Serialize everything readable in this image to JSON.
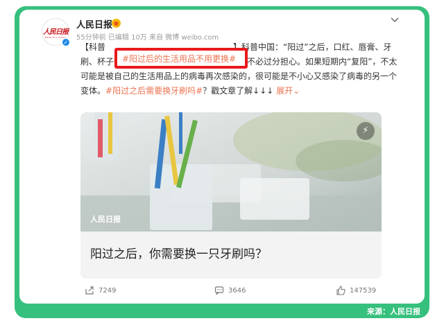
{
  "account": {
    "name": "人民日报",
    "logo_text": "人民日报",
    "logo_subtext": "PEOPLE'S DAILY",
    "meta": "55分钟前 已编辑 10万 来自 微博 weibo.com"
  },
  "post": {
    "line1_pre": "【科普",
    "line1_post": "】科普中国：“阳过”之后，口红、唇膏、牙",
    "line2": "刷、杯子都能用，其他日用品也不需要更换，不必过分担心。如果短期内“复阳”，不太",
    "line3": "可能是被自己的生活用品上的病毒再次感染的，很可能是不小心又感染了病毒的另一个",
    "line4_pre": "变体。",
    "tag2": "#阳过之后需要换牙刷吗#",
    "line4_post": "？戳文章了解↓↓↓",
    "expand_label": "展开",
    "highlight_tag": "#阳过后的生活用品不用更换#"
  },
  "media": {
    "watermark": "人民日报",
    "title": "阳过之后，你需要换一只牙刷吗？"
  },
  "actions": {
    "share_count": "7249",
    "comment_count": "3646",
    "like_count": "147539"
  },
  "caption": "来源：人民日报",
  "colors": {
    "frame": "#36c07d",
    "tag": "#eb7350",
    "highlight_border": "#e8191b"
  }
}
